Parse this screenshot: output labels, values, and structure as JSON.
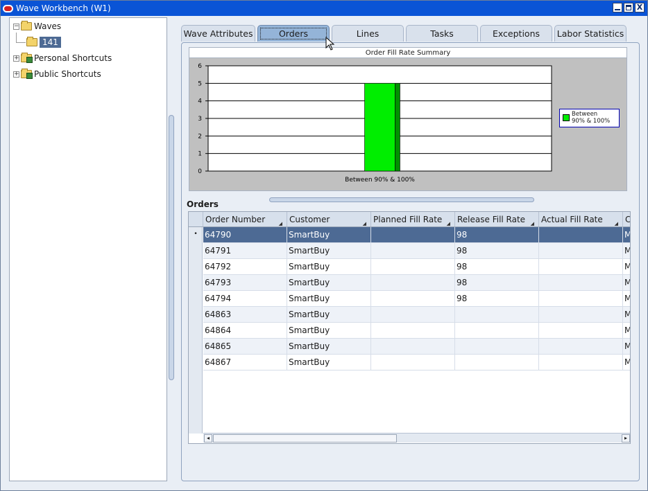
{
  "window": {
    "title": "Wave Workbench (W1)",
    "close_glyph": "X"
  },
  "tree": {
    "nodes": [
      {
        "label": "Waves",
        "expander": "−",
        "icon": "folder-open-icon"
      },
      {
        "label": "141",
        "icon": "folder-icon",
        "selected": true
      },
      {
        "label": "Personal Shortcuts",
        "expander": "+",
        "icon": "shortcut-folder-icon"
      },
      {
        "label": "Public Shortcuts",
        "expander": "+",
        "icon": "shortcut-folder-icon"
      }
    ]
  },
  "tabs": [
    {
      "label": "Wave Attributes"
    },
    {
      "label": "Orders",
      "active": true
    },
    {
      "label": "Lines"
    },
    {
      "label": "Tasks"
    },
    {
      "label": "Exceptions"
    },
    {
      "label": "Labor Statistics"
    }
  ],
  "chart_data": {
    "type": "bar",
    "title": "Order Fill Rate Summary",
    "categories": [
      "Between 90% & 100%"
    ],
    "series": [
      {
        "name": "Between 90% & 100%",
        "values": [
          5
        ]
      }
    ],
    "ylim": [
      0,
      6
    ],
    "yticks": [
      0,
      1,
      2,
      3,
      4,
      5,
      6
    ],
    "legend_lines": [
      "Between",
      "90% & 100%"
    ],
    "legend_position": "right",
    "grid": true,
    "bar_color": "#00ee00"
  },
  "orders": {
    "section_title": "Orders",
    "columns": [
      "Order Number",
      "Customer",
      "Planned Fill Rate",
      "Release Fill Rate",
      "Actual Fill Rate",
      "C"
    ],
    "rows": [
      [
        "64790",
        "SmartBuy",
        "",
        "98",
        "",
        "M"
      ],
      [
        "64791",
        "SmartBuy",
        "",
        "98",
        "",
        "M"
      ],
      [
        "64792",
        "SmartBuy",
        "",
        "98",
        "",
        "M"
      ],
      [
        "64793",
        "SmartBuy",
        "",
        "98",
        "",
        "M"
      ],
      [
        "64794",
        "SmartBuy",
        "",
        "98",
        "",
        "M"
      ],
      [
        "64863",
        "SmartBuy",
        "",
        "",
        "",
        "M"
      ],
      [
        "64864",
        "SmartBuy",
        "",
        "",
        "",
        "M"
      ],
      [
        "64865",
        "SmartBuy",
        "",
        "",
        "",
        "M"
      ],
      [
        "64867",
        "SmartBuy",
        "",
        "",
        "",
        "M"
      ]
    ],
    "selected_row": 0,
    "selected_marker": "•"
  },
  "scroll": {
    "left_glyph": "◂",
    "right_glyph": "▸"
  },
  "colors": {
    "titlebar": "#0a54d6",
    "selection": "#4d6a94",
    "active_tab": "#94b4d8",
    "bar": "#00ee00"
  }
}
